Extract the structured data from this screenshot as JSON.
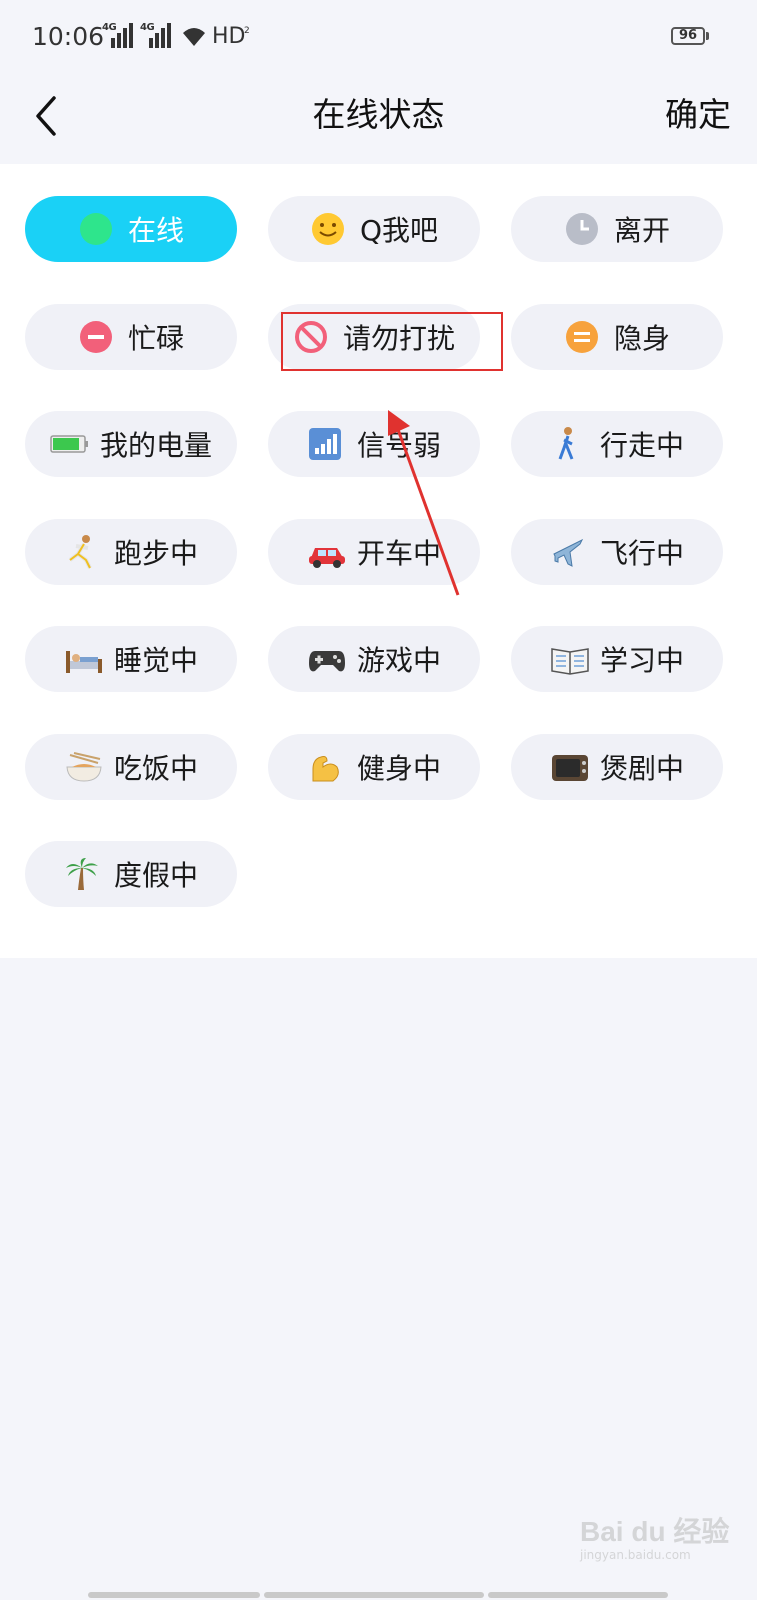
{
  "status_bar": {
    "time": "10:06",
    "signal1_label": "4G",
    "signal2_label": "4G",
    "hd_label": "HD",
    "hd_sub": "2",
    "battery_level": "96"
  },
  "header": {
    "title": "在线状态",
    "confirm_label": "确定",
    "back_icon": "chevron-left-icon"
  },
  "statuses": [
    {
      "label": "在线",
      "icon": "online-dot-icon",
      "selected": true
    },
    {
      "label": "Q我吧",
      "icon": "smiley-icon",
      "selected": false
    },
    {
      "label": "离开",
      "icon": "clock-icon",
      "selected": false
    },
    {
      "label": "忙碌",
      "icon": "busy-icon",
      "selected": false
    },
    {
      "label": "请勿打扰",
      "icon": "no-entry-icon",
      "selected": false
    },
    {
      "label": "隐身",
      "icon": "invisible-icon",
      "selected": false
    },
    {
      "label": "我的电量",
      "icon": "battery-icon",
      "selected": false
    },
    {
      "label": "信号弱",
      "icon": "signal-icon",
      "selected": false
    },
    {
      "label": "行走中",
      "icon": "walking-icon",
      "selected": false
    },
    {
      "label": "跑步中",
      "icon": "running-icon",
      "selected": false
    },
    {
      "label": "开车中",
      "icon": "car-icon",
      "selected": false
    },
    {
      "label": "飞行中",
      "icon": "airplane-icon",
      "selected": false
    },
    {
      "label": "睡觉中",
      "icon": "bed-icon",
      "selected": false
    },
    {
      "label": "游戏中",
      "icon": "gamepad-icon",
      "selected": false
    },
    {
      "label": "学习中",
      "icon": "book-icon",
      "selected": false
    },
    {
      "label": "吃饭中",
      "icon": "noodle-bowl-icon",
      "selected": false
    },
    {
      "label": "健身中",
      "icon": "flexed-biceps-icon",
      "selected": false
    },
    {
      "label": "煲剧中",
      "icon": "television-icon",
      "selected": false
    },
    {
      "label": "度假中",
      "icon": "palm-tree-icon",
      "selected": false
    }
  ],
  "annotation": {
    "highlight_target": "请勿打扰",
    "color": "#e0322f"
  },
  "watermark": {
    "text": "Bai du 经验",
    "sub": "jingyan.baidu.com"
  },
  "colors": {
    "accent": "#1ad1f6",
    "pill_bg": "#f0f1f7",
    "page_bg": "#f4f5fa"
  }
}
